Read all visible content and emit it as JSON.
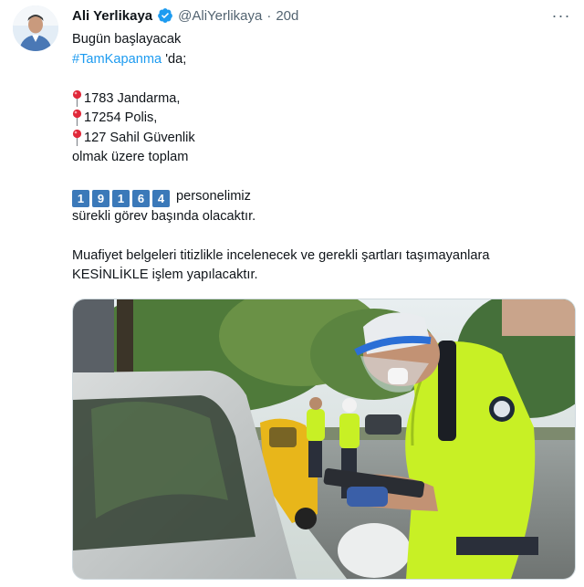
{
  "author": {
    "name": "Ali Yerlikaya",
    "handle": "@AliYerlikaya",
    "separator": "·",
    "time": "20d",
    "verified_icon": "verified-badge-icon",
    "avatar_icon": "profile-photo"
  },
  "more_icon": "more-dots-icon",
  "more_label": "···",
  "tweet": {
    "line1": "Bugün başlayacak",
    "hashtag": "#TamKapanma",
    "hashtag_suffix": " 'da;",
    "items": [
      {
        "icon": "round-pushpin-icon",
        "text": "1783 Jandarma,"
      },
      {
        "icon": "round-pushpin-icon",
        "text": "17254 Polis,"
      },
      {
        "icon": "round-pushpin-icon",
        "text": "127 Sahil Güvenlik"
      }
    ],
    "line_total": "olmak üzere toplam",
    "digits": [
      "1",
      "9",
      "1",
      "6",
      "4"
    ],
    "after_digits": "personelimiz",
    "line_duty": "sürekli görev başında olacaktır.",
    "line_check": "Muafiyet belgeleri titizlikle incelenecek ve gerekli şartları taşımayanlara",
    "line_action": "KESİNLİKLE işlem yapılacaktır."
  },
  "media": {
    "description_icon": "photo-police-checkpoint"
  },
  "colors": {
    "link": "#1d9bf0",
    "digit_box": "#3b79b9",
    "muted": "#536471",
    "vest": "#c8f025"
  }
}
